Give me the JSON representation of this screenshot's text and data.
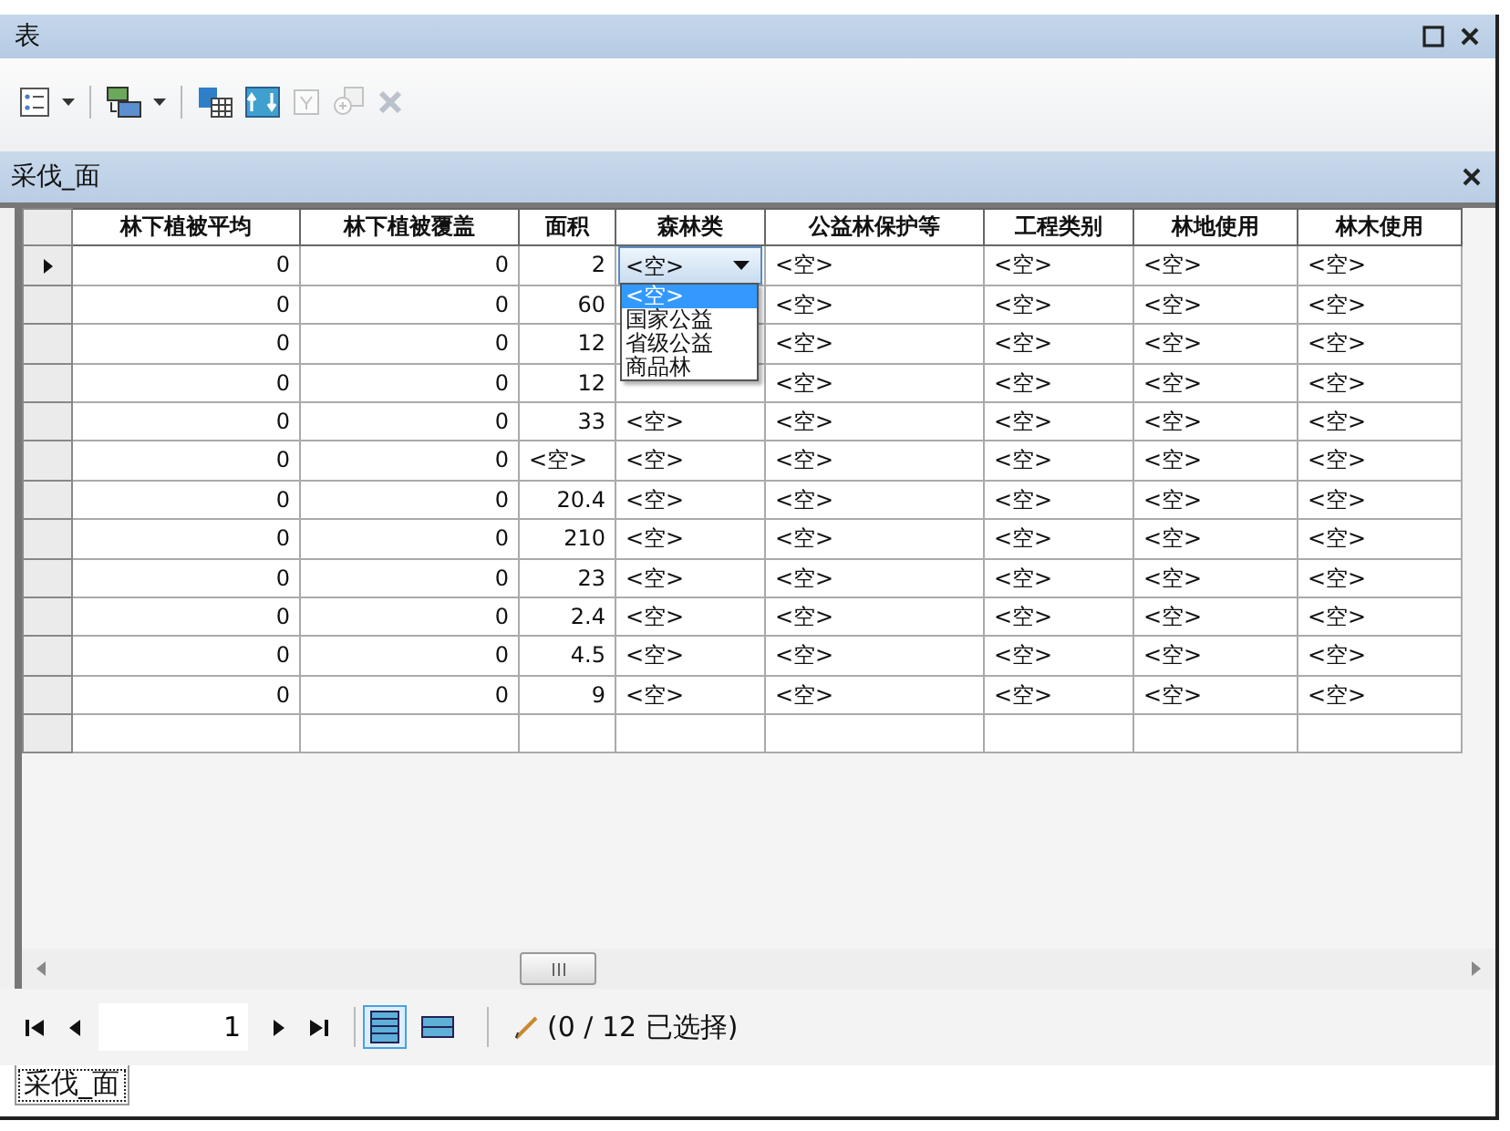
{
  "window": {
    "title": "表"
  },
  "toolbar": [
    {
      "kind": "table-options",
      "disabled": false
    },
    {
      "kind": "related-tables",
      "disabled": false
    },
    {
      "kind": "select-by-attributes",
      "disabled": false
    },
    {
      "kind": "switch-selection",
      "disabled": false
    },
    {
      "kind": "clear-selection",
      "disabled": true
    },
    {
      "kind": "zoom-selected",
      "disabled": true
    },
    {
      "kind": "delete",
      "disabled": true
    }
  ],
  "table": {
    "title": "采伐_面",
    "columns": [
      "林下植被平均",
      "林下植被覆盖",
      "面积",
      "森林类",
      "公益林保护等",
      "工程类别",
      "林地使用",
      "林木使用"
    ],
    "rows": [
      {
        "current": true,
        "cells": [
          "0",
          "0",
          "2",
          {
            "kind": "combo",
            "value": "<空>",
            "options": [
              {
                "label": "<空>",
                "selected": true
              },
              {
                "label": "国家公益",
                "selected": false
              },
              {
                "label": "省级公益",
                "selected": false
              },
              {
                "label": "商品林",
                "selected": false
              }
            ]
          },
          "<空>",
          "<空>",
          "<空>",
          "<空>"
        ]
      },
      {
        "current": false,
        "cells": [
          "0",
          "0",
          "60",
          null,
          "<空>",
          "<空>",
          "<空>",
          "<空>"
        ]
      },
      {
        "current": false,
        "cells": [
          "0",
          "0",
          "12",
          null,
          "<空>",
          "<空>",
          "<空>",
          "<空>"
        ]
      },
      {
        "current": false,
        "cells": [
          "0",
          "0",
          "12",
          null,
          "<空>",
          "<空>",
          "<空>",
          "<空>"
        ]
      },
      {
        "current": false,
        "cells": [
          "0",
          "0",
          "33",
          "<空>",
          "<空>",
          "<空>",
          "<空>",
          "<空>"
        ]
      },
      {
        "current": false,
        "cells": [
          "0",
          "0",
          "<空>",
          "<空>",
          "<空>",
          "<空>",
          "<空>",
          "<空>"
        ]
      },
      {
        "current": false,
        "cells": [
          "0",
          "0",
          "20.4",
          "<空>",
          "<空>",
          "<空>",
          "<空>",
          "<空>"
        ]
      },
      {
        "current": false,
        "cells": [
          "0",
          "0",
          "210",
          "<空>",
          "<空>",
          "<空>",
          "<空>",
          "<空>"
        ]
      },
      {
        "current": false,
        "cells": [
          "0",
          "0",
          "23",
          "<空>",
          "<空>",
          "<空>",
          "<空>",
          "<空>"
        ]
      },
      {
        "current": false,
        "cells": [
          "0",
          "0",
          "2.4",
          "<空>",
          "<空>",
          "<空>",
          "<空>",
          "<空>"
        ]
      },
      {
        "current": false,
        "cells": [
          "0",
          "0",
          "4.5",
          "<空>",
          "<空>",
          "<空>",
          "<空>",
          "<空>"
        ]
      },
      {
        "current": false,
        "cells": [
          "0",
          "0",
          "9",
          "<空>",
          "<空>",
          "<空>",
          "<空>",
          "<空>"
        ]
      }
    ]
  },
  "navigator": {
    "record": "1",
    "views": [
      {
        "kind": "all",
        "selected": true
      },
      {
        "kind": "selected",
        "selected": false
      }
    ],
    "status": "(0 / 12 已选择)"
  },
  "tabs": [
    {
      "label": "采伐_面",
      "selected": true
    }
  ]
}
